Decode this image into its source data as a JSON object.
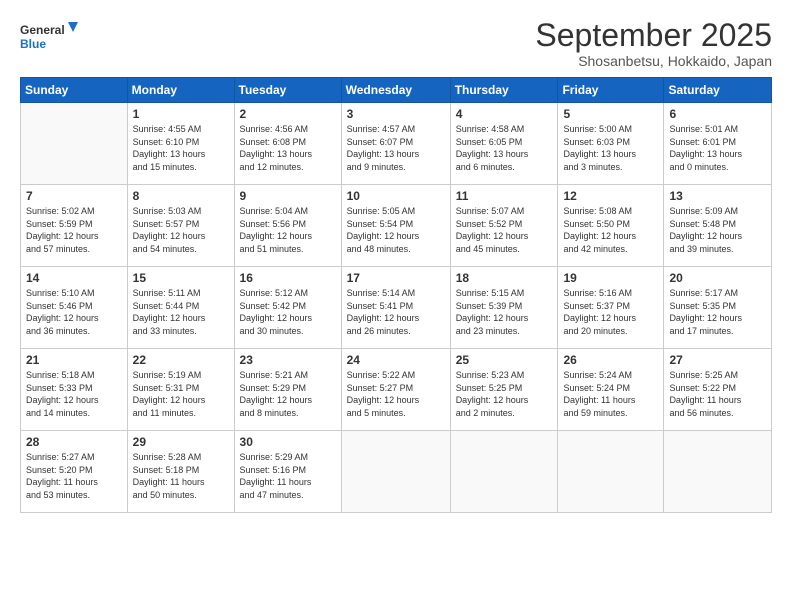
{
  "logo": {
    "line1": "General",
    "line2": "Blue"
  },
  "title": "September 2025",
  "location": "Shosanbetsu, Hokkaido, Japan",
  "weekdays": [
    "Sunday",
    "Monday",
    "Tuesday",
    "Wednesday",
    "Thursday",
    "Friday",
    "Saturday"
  ],
  "weeks": [
    [
      {
        "day": "",
        "info": ""
      },
      {
        "day": "1",
        "info": "Sunrise: 4:55 AM\nSunset: 6:10 PM\nDaylight: 13 hours\nand 15 minutes."
      },
      {
        "day": "2",
        "info": "Sunrise: 4:56 AM\nSunset: 6:08 PM\nDaylight: 13 hours\nand 12 minutes."
      },
      {
        "day": "3",
        "info": "Sunrise: 4:57 AM\nSunset: 6:07 PM\nDaylight: 13 hours\nand 9 minutes."
      },
      {
        "day": "4",
        "info": "Sunrise: 4:58 AM\nSunset: 6:05 PM\nDaylight: 13 hours\nand 6 minutes."
      },
      {
        "day": "5",
        "info": "Sunrise: 5:00 AM\nSunset: 6:03 PM\nDaylight: 13 hours\nand 3 minutes."
      },
      {
        "day": "6",
        "info": "Sunrise: 5:01 AM\nSunset: 6:01 PM\nDaylight: 13 hours\nand 0 minutes."
      }
    ],
    [
      {
        "day": "7",
        "info": "Sunrise: 5:02 AM\nSunset: 5:59 PM\nDaylight: 12 hours\nand 57 minutes."
      },
      {
        "day": "8",
        "info": "Sunrise: 5:03 AM\nSunset: 5:57 PM\nDaylight: 12 hours\nand 54 minutes."
      },
      {
        "day": "9",
        "info": "Sunrise: 5:04 AM\nSunset: 5:56 PM\nDaylight: 12 hours\nand 51 minutes."
      },
      {
        "day": "10",
        "info": "Sunrise: 5:05 AM\nSunset: 5:54 PM\nDaylight: 12 hours\nand 48 minutes."
      },
      {
        "day": "11",
        "info": "Sunrise: 5:07 AM\nSunset: 5:52 PM\nDaylight: 12 hours\nand 45 minutes."
      },
      {
        "day": "12",
        "info": "Sunrise: 5:08 AM\nSunset: 5:50 PM\nDaylight: 12 hours\nand 42 minutes."
      },
      {
        "day": "13",
        "info": "Sunrise: 5:09 AM\nSunset: 5:48 PM\nDaylight: 12 hours\nand 39 minutes."
      }
    ],
    [
      {
        "day": "14",
        "info": "Sunrise: 5:10 AM\nSunset: 5:46 PM\nDaylight: 12 hours\nand 36 minutes."
      },
      {
        "day": "15",
        "info": "Sunrise: 5:11 AM\nSunset: 5:44 PM\nDaylight: 12 hours\nand 33 minutes."
      },
      {
        "day": "16",
        "info": "Sunrise: 5:12 AM\nSunset: 5:42 PM\nDaylight: 12 hours\nand 30 minutes."
      },
      {
        "day": "17",
        "info": "Sunrise: 5:14 AM\nSunset: 5:41 PM\nDaylight: 12 hours\nand 26 minutes."
      },
      {
        "day": "18",
        "info": "Sunrise: 5:15 AM\nSunset: 5:39 PM\nDaylight: 12 hours\nand 23 minutes."
      },
      {
        "day": "19",
        "info": "Sunrise: 5:16 AM\nSunset: 5:37 PM\nDaylight: 12 hours\nand 20 minutes."
      },
      {
        "day": "20",
        "info": "Sunrise: 5:17 AM\nSunset: 5:35 PM\nDaylight: 12 hours\nand 17 minutes."
      }
    ],
    [
      {
        "day": "21",
        "info": "Sunrise: 5:18 AM\nSunset: 5:33 PM\nDaylight: 12 hours\nand 14 minutes."
      },
      {
        "day": "22",
        "info": "Sunrise: 5:19 AM\nSunset: 5:31 PM\nDaylight: 12 hours\nand 11 minutes."
      },
      {
        "day": "23",
        "info": "Sunrise: 5:21 AM\nSunset: 5:29 PM\nDaylight: 12 hours\nand 8 minutes."
      },
      {
        "day": "24",
        "info": "Sunrise: 5:22 AM\nSunset: 5:27 PM\nDaylight: 12 hours\nand 5 minutes."
      },
      {
        "day": "25",
        "info": "Sunrise: 5:23 AM\nSunset: 5:25 PM\nDaylight: 12 hours\nand 2 minutes."
      },
      {
        "day": "26",
        "info": "Sunrise: 5:24 AM\nSunset: 5:24 PM\nDaylight: 11 hours\nand 59 minutes."
      },
      {
        "day": "27",
        "info": "Sunrise: 5:25 AM\nSunset: 5:22 PM\nDaylight: 11 hours\nand 56 minutes."
      }
    ],
    [
      {
        "day": "28",
        "info": "Sunrise: 5:27 AM\nSunset: 5:20 PM\nDaylight: 11 hours\nand 53 minutes."
      },
      {
        "day": "29",
        "info": "Sunrise: 5:28 AM\nSunset: 5:18 PM\nDaylight: 11 hours\nand 50 minutes."
      },
      {
        "day": "30",
        "info": "Sunrise: 5:29 AM\nSunset: 5:16 PM\nDaylight: 11 hours\nand 47 minutes."
      },
      {
        "day": "",
        "info": ""
      },
      {
        "day": "",
        "info": ""
      },
      {
        "day": "",
        "info": ""
      },
      {
        "day": "",
        "info": ""
      }
    ]
  ]
}
